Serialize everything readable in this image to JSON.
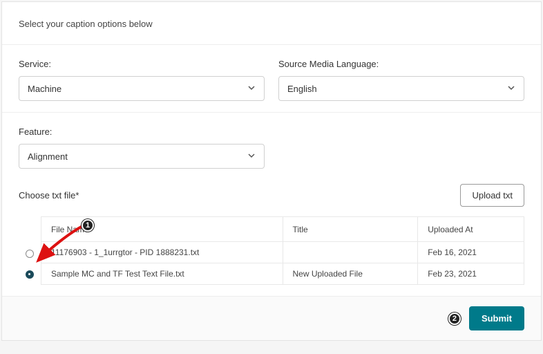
{
  "header": {
    "instruction": "Select your caption options below"
  },
  "fields": {
    "service": {
      "label": "Service:",
      "value": "Machine"
    },
    "language": {
      "label": "Source Media Language:",
      "value": "English"
    },
    "feature": {
      "label": "Feature:",
      "value": "Alignment"
    }
  },
  "file_section": {
    "label": "Choose txt file*",
    "upload_button": "Upload txt",
    "columns": {
      "filename": "File Name",
      "title": "Title",
      "uploaded": "Uploaded At"
    },
    "rows": [
      {
        "selected": false,
        "filename": "11176903 - 1_1urrgtor - PID 1888231.txt",
        "title": "",
        "uploaded": "Feb 16, 2021"
      },
      {
        "selected": true,
        "filename": "Sample MC and TF Test Text File.txt",
        "title": "New Uploaded File",
        "uploaded": "Feb 23, 2021"
      }
    ]
  },
  "footer": {
    "submit": "Submit"
  },
  "annotations": {
    "badge1": "1",
    "badge2": "2"
  }
}
